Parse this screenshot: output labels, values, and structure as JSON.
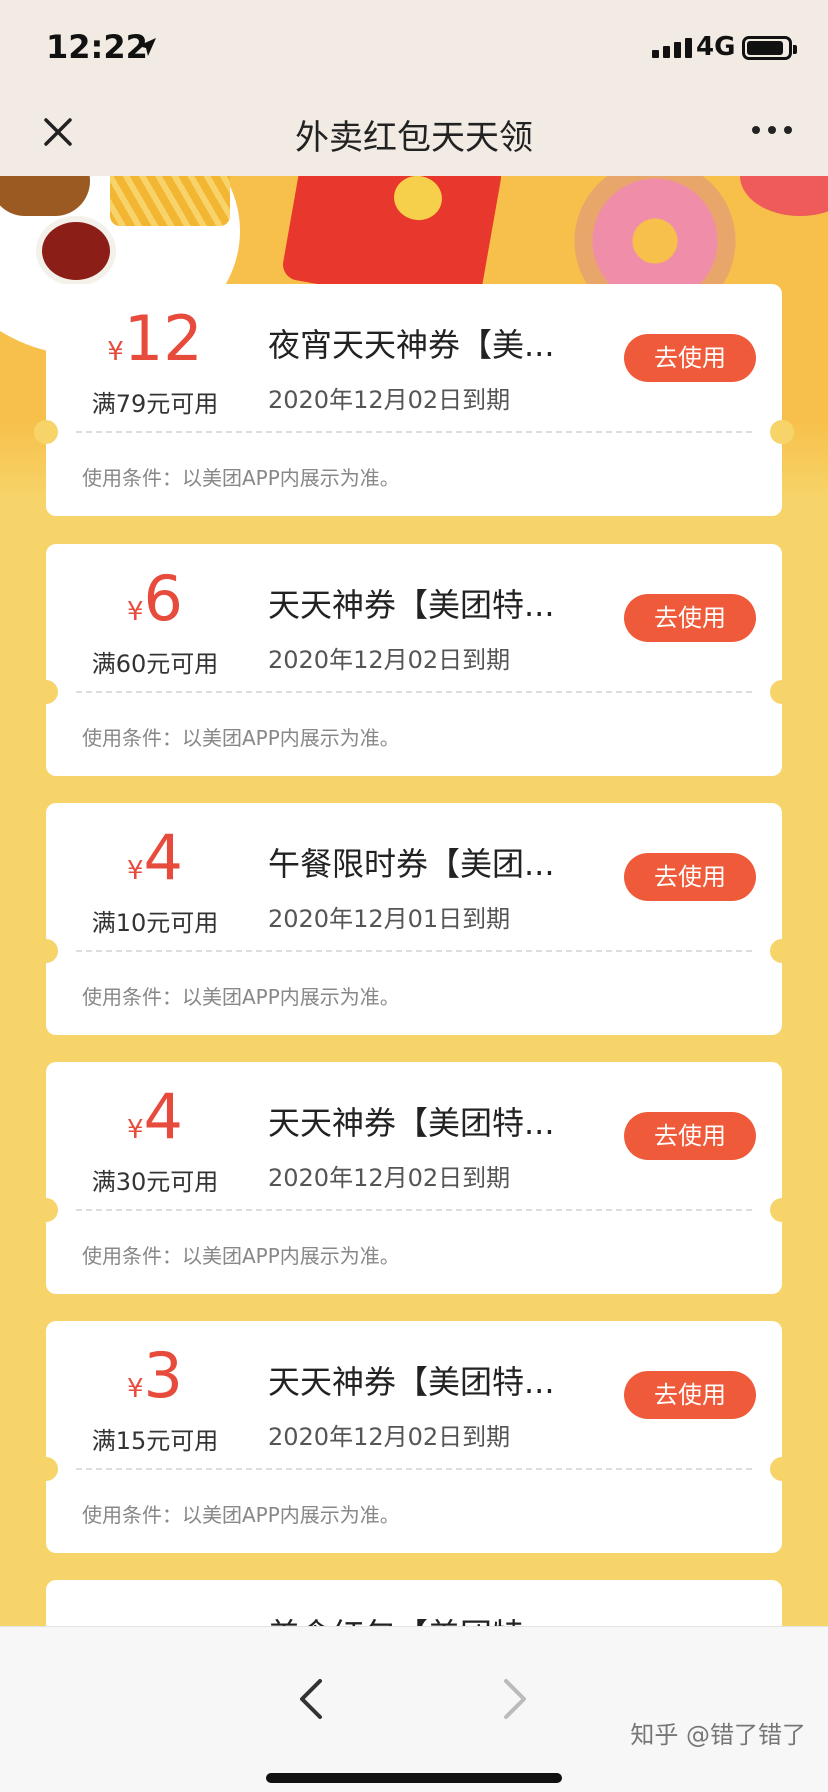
{
  "status": {
    "time": "12:22",
    "network": "4G"
  },
  "nav": {
    "title": "外卖红包天天领"
  },
  "coupons": [
    {
      "currency": "¥",
      "amount": "12",
      "min_spend": "满79元可用",
      "title": "夜宵天天神券【美...",
      "expiry": "2020年12月02日到期",
      "button": "去使用",
      "condition": "使用条件：以美团APP内展示为准。"
    },
    {
      "currency": "¥",
      "amount": "6",
      "min_spend": "满60元可用",
      "title": "天天神券【美团特...",
      "expiry": "2020年12月02日到期",
      "button": "去使用",
      "condition": "使用条件：以美团APP内展示为准。"
    },
    {
      "currency": "¥",
      "amount": "4",
      "min_spend": "满10元可用",
      "title": "午餐限时券【美团...",
      "expiry": "2020年12月01日到期",
      "button": "去使用",
      "condition": "使用条件：以美团APP内展示为准。"
    },
    {
      "currency": "¥",
      "amount": "4",
      "min_spend": "满30元可用",
      "title": "天天神券【美团特...",
      "expiry": "2020年12月02日到期",
      "button": "去使用",
      "condition": "使用条件：以美团APP内展示为准。"
    },
    {
      "currency": "¥",
      "amount": "3",
      "min_spend": "满15元可用",
      "title": "天天神券【美团特...",
      "expiry": "2020年12月02日到期",
      "button": "去使用",
      "condition": "使用条件：以美团APP内展示为准。"
    },
    {
      "currency": "",
      "amount": "",
      "min_spend": "",
      "title": "美食红包【美团特...",
      "expiry": "",
      "button": "",
      "condition": ""
    }
  ],
  "watermark": "知乎 @错了错了",
  "colors": {
    "accent": "#ef5b3a",
    "amount": "#e64b3c",
    "background": "#f7d46a"
  }
}
